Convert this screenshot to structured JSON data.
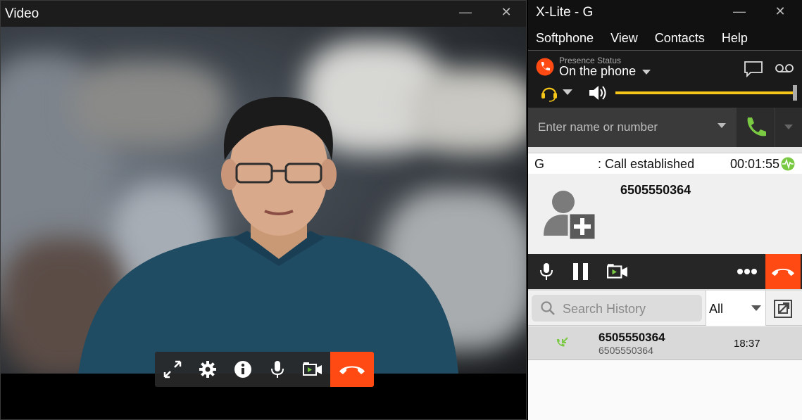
{
  "video_window": {
    "title": "Video",
    "minimize": "—",
    "close": "✕"
  },
  "xlite": {
    "title": "X-Lite - G",
    "minimize": "—",
    "close": "✕",
    "menu": [
      "Softphone",
      "View",
      "Contacts",
      "Help"
    ],
    "presence": {
      "caption": "Presence Status",
      "status": "On the phone"
    },
    "dial": {
      "placeholder": "Enter name or number"
    },
    "call": {
      "line": "G",
      "status": ": Call established",
      "duration": "00:01:55",
      "number": "6505550364"
    },
    "history": {
      "search_placeholder": "Search History",
      "filter": "All",
      "items": [
        {
          "name": "6505550364",
          "number": "6505550364",
          "time": "18:37"
        }
      ]
    },
    "colors": {
      "accent_yellow": "#f5c518",
      "end_call": "#ff4b13",
      "call_green": "#7ac943"
    }
  },
  "icons": {
    "fullscreen": "fullscreen-icon",
    "settings": "gear-icon",
    "info": "info-icon",
    "mic": "microphone-icon",
    "video": "video-camera-icon",
    "end": "hangup-icon"
  }
}
